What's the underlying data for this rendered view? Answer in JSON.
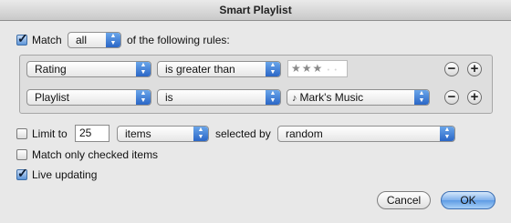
{
  "window": {
    "title": "Smart Playlist"
  },
  "match": {
    "label": "Match",
    "checked": true,
    "mode": "all",
    "suffix": "of the following rules:"
  },
  "rules": [
    {
      "field": "Rating",
      "operator": "is greater than",
      "value_type": "stars",
      "rating": 3,
      "rating_max": 5
    },
    {
      "field": "Playlist",
      "operator": "is",
      "value_type": "popup",
      "value": "Mark's Music",
      "value_icon": "music-note-icon"
    }
  ],
  "rule_buttons": {
    "remove": "−",
    "add": "+"
  },
  "limit": {
    "label": "Limit to",
    "checked": false,
    "value": "25",
    "unit": "items",
    "selected_by_label": "selected by",
    "selected_by": "random"
  },
  "match_checked": {
    "label": "Match only checked items",
    "checked": false
  },
  "live_updating": {
    "label": "Live updating",
    "checked": true
  },
  "buttons": {
    "cancel": "Cancel",
    "ok": "OK"
  },
  "colors": {
    "accent": "#3a7be0",
    "window_bg": "#e8e8e8"
  }
}
